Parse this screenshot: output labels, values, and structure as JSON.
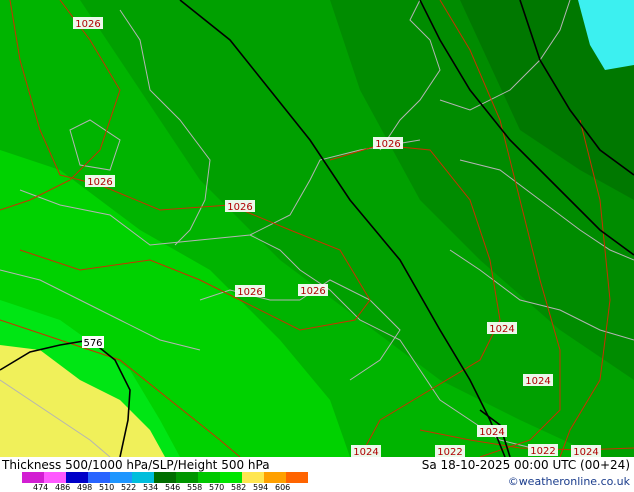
{
  "pressure_labels": [
    {
      "text": "1026"
    },
    {
      "text": "1026"
    },
    {
      "text": "1026"
    },
    {
      "text": "1026"
    },
    {
      "text": "1026"
    },
    {
      "text": "1026"
    },
    {
      "text": "1024"
    },
    {
      "text": "1024"
    },
    {
      "text": "1024"
    },
    {
      "text": "1024"
    },
    {
      "text": "1022"
    },
    {
      "text": "1022"
    },
    {
      "text": "1024"
    }
  ],
  "height_label": "576",
  "footer": {
    "title": "Thickness 500/1000 hPa/SLP/Height 500 hPa",
    "datetime": "Sa 18-10-2025 00:00 UTC (00+24)",
    "credit": "©weatheronline.co.uk"
  },
  "legend": {
    "ticks": [
      "474",
      "486",
      "498",
      "510",
      "522",
      "534",
      "546",
      "558",
      "570",
      "582",
      "594",
      "606"
    ],
    "colors": [
      "#d21ed2",
      "#ff5aff",
      "#0000c8",
      "#2864ff",
      "#1e96ff",
      "#00bedc",
      "#006e00",
      "#009600",
      "#00c800",
      "#00e600",
      "#ffe650",
      "#ffa000",
      "#ff6400"
    ]
  },
  "colors": {
    "thickness_546": "#007800",
    "thickness_552": "#008c00",
    "thickness_558": "#00a000",
    "thickness_564": "#00b400",
    "thickness_570": "#00d200",
    "thickness_576": "#00e614",
    "thickness_582": "#f0f05a",
    "cold_core": "#3cf0f0",
    "coastline": "#b4b4b4",
    "isobar": "#c83200",
    "height_contour": "#000000"
  }
}
